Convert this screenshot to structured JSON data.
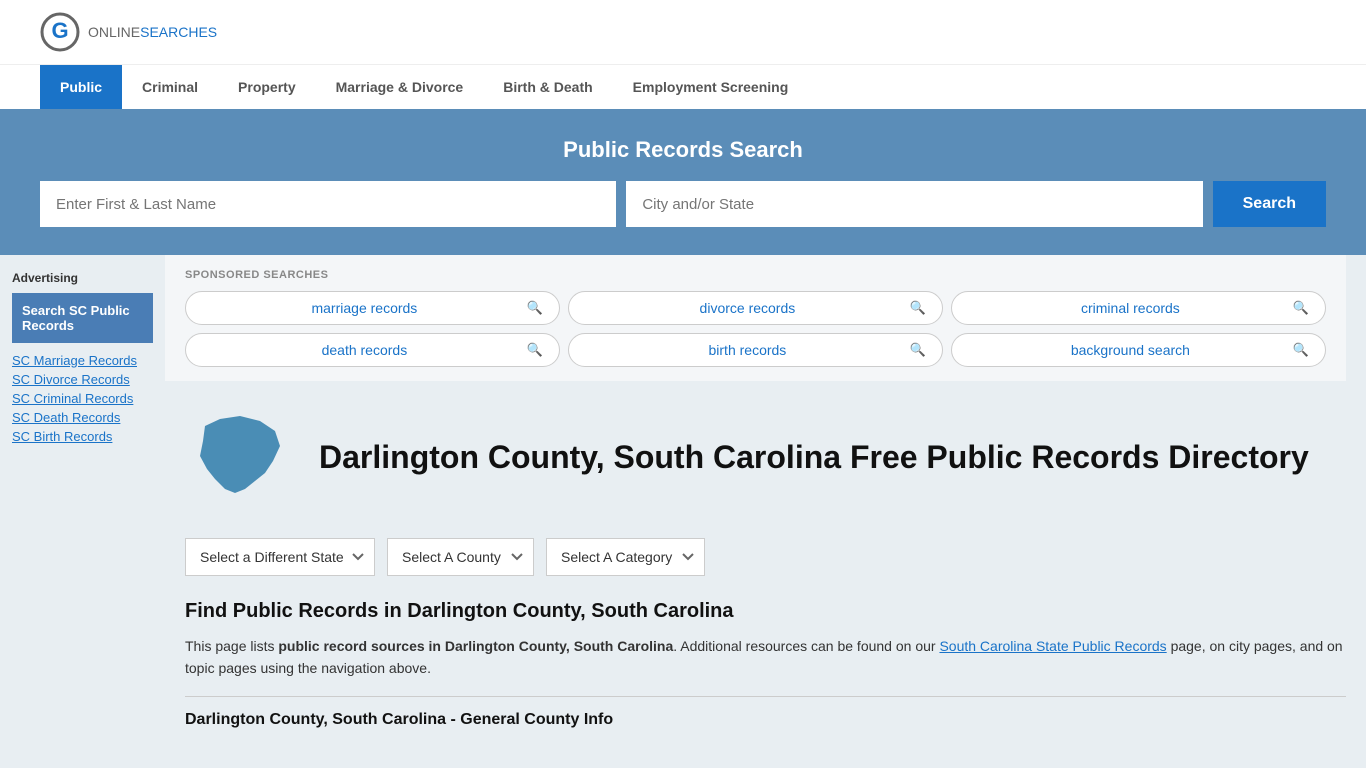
{
  "site": {
    "logo_online": "ONLINE",
    "logo_searches": "SEARCHES"
  },
  "nav": {
    "items": [
      {
        "label": "Public",
        "active": true
      },
      {
        "label": "Criminal",
        "active": false
      },
      {
        "label": "Property",
        "active": false
      },
      {
        "label": "Marriage & Divorce",
        "active": false
      },
      {
        "label": "Birth & Death",
        "active": false
      },
      {
        "label": "Employment Screening",
        "active": false
      }
    ]
  },
  "search_banner": {
    "title": "Public Records Search",
    "name_placeholder": "Enter First & Last Name",
    "location_placeholder": "City and/or State",
    "button_label": "Search"
  },
  "sponsored": {
    "label": "SPONSORED SEARCHES",
    "items": [
      {
        "text": "marriage records"
      },
      {
        "text": "divorce records"
      },
      {
        "text": "criminal records"
      },
      {
        "text": "death records"
      },
      {
        "text": "birth records"
      },
      {
        "text": "background search"
      }
    ]
  },
  "sidebar": {
    "ad_label": "Advertising",
    "ad_box_text": "Search SC Public Records",
    "links": [
      {
        "text": "SC Marriage Records"
      },
      {
        "text": "SC Divorce Records"
      },
      {
        "text": "SC Criminal Records"
      },
      {
        "text": "SC Death Records"
      },
      {
        "text": "SC Birth Records"
      }
    ]
  },
  "page": {
    "county_title": "Darlington County, South Carolina Free Public Records Directory",
    "dropdown_state": "Select a Different State",
    "dropdown_county": "Select A County",
    "dropdown_category": "Select A Category",
    "find_title": "Find Public Records in Darlington County, South Carolina",
    "find_text_1": "This page lists ",
    "find_bold": "public record sources in Darlington County, South Carolina",
    "find_text_2": ". Additional resources can be found on our ",
    "find_link": "South Carolina State Public Records",
    "find_text_3": " page, on city pages, and on topic pages using the navigation above.",
    "section_subtitle": "Darlington County, South Carolina - General County Info"
  }
}
